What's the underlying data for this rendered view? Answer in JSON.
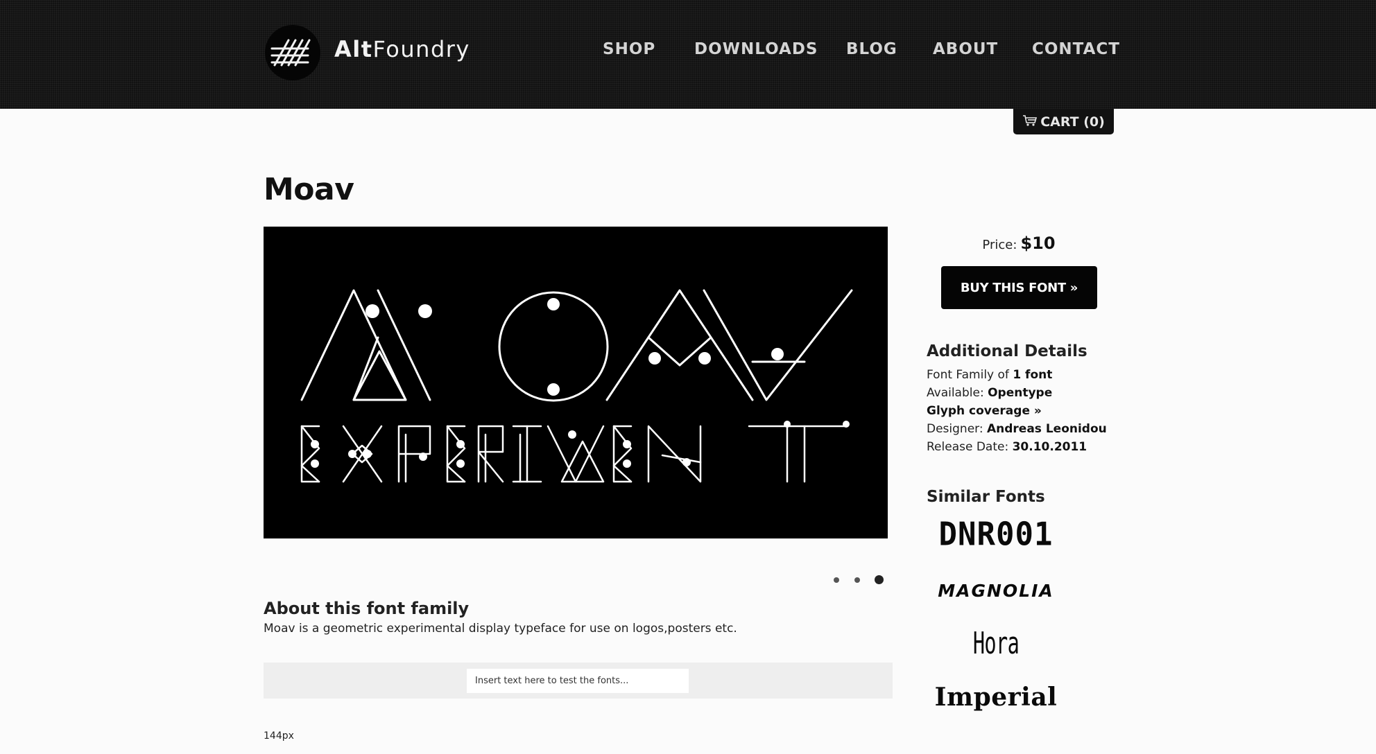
{
  "brand": {
    "name_bold": "Alt",
    "name_light": "Foundry"
  },
  "nav": {
    "items": [
      {
        "label": "SHOP"
      },
      {
        "label": "DOWNLOADS"
      },
      {
        "label": "BLOG"
      },
      {
        "label": "ABOUT"
      },
      {
        "label": "CONTACT"
      }
    ]
  },
  "cart": {
    "label": "CART (0)"
  },
  "page": {
    "title": "Moav"
  },
  "hero": {
    "line1": "MOAV",
    "line2": "EXPERIMENT"
  },
  "slider": {
    "count": 3,
    "active_index": 2
  },
  "about": {
    "heading": "About this font family",
    "text": "Moav is a geometric experimental display typeface for use on logos,posters etc."
  },
  "tester": {
    "placeholder": "Insert text here to test the fonts...",
    "size": "144px"
  },
  "sidebar": {
    "price_label": "Price:",
    "price_value": "$10",
    "buy_label": "BUY THIS FONT »",
    "details_heading": "Additional Details",
    "details": {
      "family_label": "Font Family of ",
      "family_value": "1 font",
      "available_label": "Available: ",
      "available_value": "Opentype",
      "glyph_link": "Glyph coverage »",
      "designer_label": "Designer: ",
      "designer_value": "Andreas Leonidou",
      "release_label": "Release Date: ",
      "release_value": "30.10.2011"
    },
    "similar_heading": "Similar Fonts",
    "similar_fonts": [
      "DNR001",
      "MAGNOLIA",
      "Hora",
      "Imperial"
    ]
  }
}
